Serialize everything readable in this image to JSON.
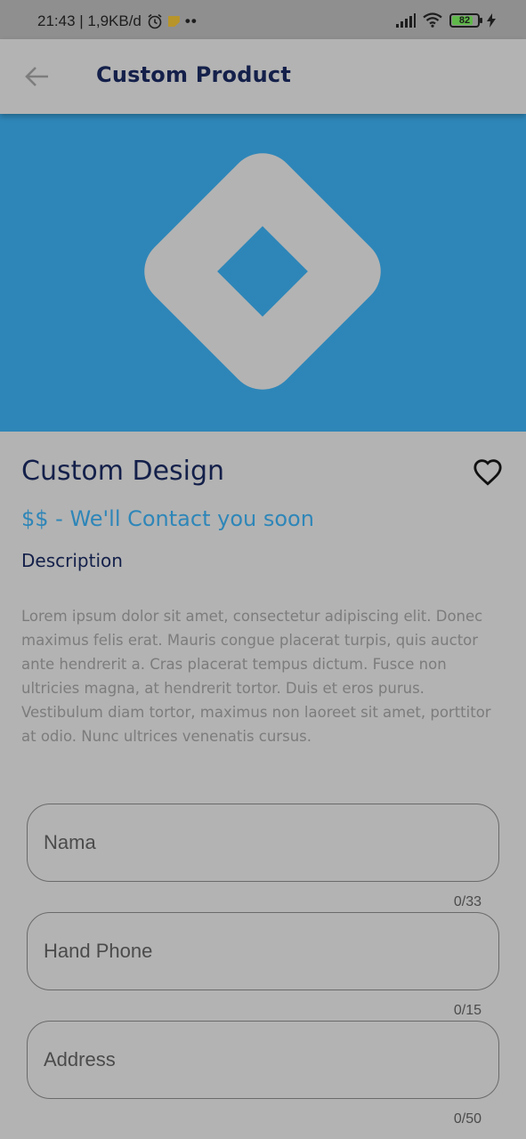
{
  "status_bar": {
    "time_speed": "21:43 | 1,9KB/d",
    "more": "••",
    "battery_level": 82,
    "battery_text": "82",
    "icons": [
      "alarm-icon",
      "note-icon",
      "signal-icon",
      "wifi-icon",
      "battery-icon",
      "charging-icon"
    ]
  },
  "app_bar": {
    "title": "Custom Product",
    "back_icon": "arrow-left-icon"
  },
  "hero": {
    "background_color": "#2e86b8",
    "logo_icon": "diamond-logo-icon"
  },
  "product": {
    "name": "Custom Design",
    "price": "$$ - We'll Contact you soon",
    "favorite_icon": "heart-outline-icon",
    "description_heading": "Description",
    "description": "Lorem ipsum dolor sit amet, consectetur adipiscing elit. Donec maximus felis erat. Mauris congue placerat turpis, quis auctor ante hendrerit a. Cras placerat tempus dictum. Fusce non ultricies magna, at hendrerit tortor. Duis et eros purus. Vestibulum diam tortor, maximus non laoreet sit amet, porttitor at odio. Nunc ultrices venenatis cursus."
  },
  "form": {
    "name": {
      "placeholder": "Nama",
      "value": "",
      "counter": "0/33"
    },
    "phone": {
      "placeholder": "Hand Phone",
      "value": "",
      "counter": "0/15"
    },
    "address": {
      "placeholder": "Address",
      "value": "",
      "counter": "0/50"
    }
  },
  "colors": {
    "primary": "#2e86b8",
    "title": "#14204a",
    "overlay": "#b3b3b3"
  }
}
